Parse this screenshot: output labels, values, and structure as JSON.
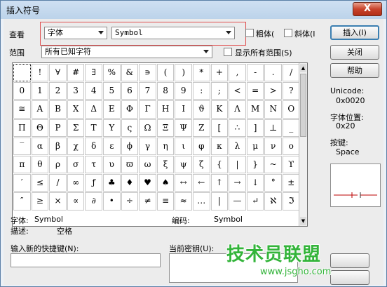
{
  "window": {
    "title": "插入符号",
    "close_label": "X"
  },
  "toolbar": {
    "view_label": "查看",
    "font_set_value": "字体",
    "font_value": "Symbol",
    "bold_label": "粗体(",
    "italic_label": "斜体(I",
    "insert_label": "插入(I)",
    "range_label": "范围",
    "range_value": "所有已知字符",
    "show_all_label": "显示所有范围(S)",
    "close_button": "关闭",
    "help_button": "帮助"
  },
  "info": {
    "unicode_label": "Unicode:",
    "unicode_value": "0x0020",
    "position_label": "字体位置:",
    "position_value": "0x20",
    "key_label": "按键:",
    "key_value": "Space"
  },
  "status": {
    "font_label": "字体:",
    "font_value": "Symbol",
    "encoding_label": "编码:",
    "encoding_value": "Symbol",
    "desc_label": "描述:",
    "desc_value": "空格"
  },
  "shortcut": {
    "new_label": "输入新的快捷键(N):",
    "current_label": "当前密钥(U):"
  },
  "watermark": {
    "title": "技术员联盟",
    "url": "www.jsgho.com"
  },
  "symbols": [
    [
      " ",
      "!",
      "∀",
      "#",
      "∃",
      "%",
      "&",
      "∍",
      "(",
      ")",
      "*",
      "+",
      ",",
      "-",
      ".",
      "/"
    ],
    [
      "0",
      "1",
      "2",
      "3",
      "4",
      "5",
      "6",
      "7",
      "8",
      "9",
      ":",
      ";",
      "<",
      "=",
      ">",
      "?"
    ],
    [
      "≅",
      "Α",
      "Β",
      "Χ",
      "Δ",
      "Ε",
      "Φ",
      "Γ",
      "Η",
      "Ι",
      "ϑ",
      "Κ",
      "Λ",
      "Μ",
      "Ν",
      "Ο"
    ],
    [
      "Π",
      "Θ",
      "Ρ",
      "Σ",
      "Τ",
      "Υ",
      "ς",
      "Ω",
      "Ξ",
      "Ψ",
      "Ζ",
      "[",
      "∴",
      "]",
      "⊥",
      "_"
    ],
    [
      "‾",
      "α",
      "β",
      "χ",
      "δ",
      "ε",
      "ϕ",
      "γ",
      "η",
      "ι",
      "φ",
      "κ",
      "λ",
      "μ",
      "ν",
      "ο"
    ],
    [
      "π",
      "θ",
      "ρ",
      "σ",
      "τ",
      "υ",
      "ϖ",
      "ω",
      "ξ",
      "ψ",
      "ζ",
      "{",
      "|",
      "}",
      "~",
      "ϒ"
    ],
    [
      "′",
      "≤",
      "/",
      "∞",
      "ƒ",
      "♣",
      "♦",
      "♥",
      "♠",
      "↔",
      "←",
      "↑",
      "→",
      "↓",
      "°",
      "±"
    ],
    [
      "″",
      "≥",
      "×",
      "∝",
      "∂",
      "•",
      "÷",
      "≠",
      "≡",
      "≈",
      "…",
      "|",
      "—",
      "↵",
      "ℵ",
      "ℑ"
    ]
  ]
}
